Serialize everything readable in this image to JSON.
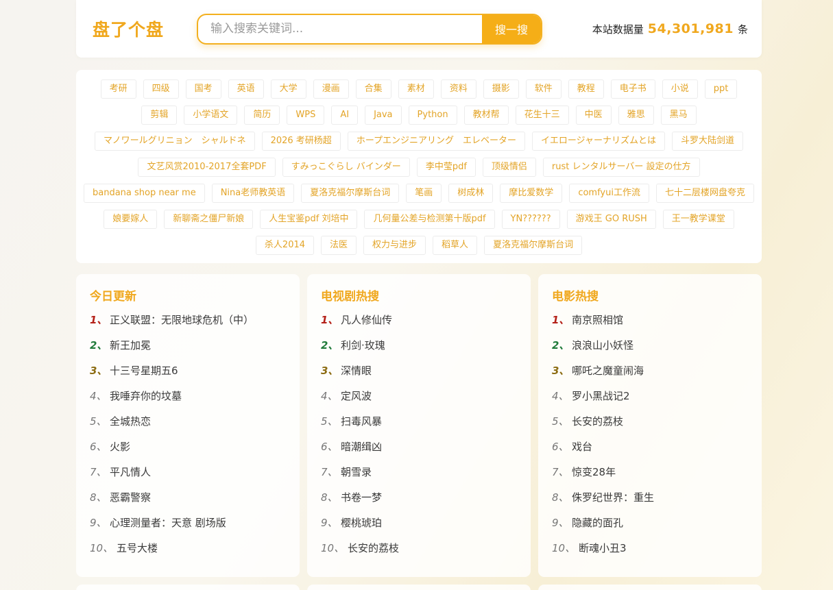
{
  "header": {
    "logo": "盘了个盘",
    "search_placeholder": "输入搜索关键词...",
    "search_button": "搜一搜",
    "stats_prefix": "本站数据量",
    "stats_count": "54,301,981",
    "stats_suffix": "条"
  },
  "tags": [
    "考研",
    "四级",
    "国考",
    "英语",
    "大学",
    "漫画",
    "合集",
    "素材",
    "资料",
    "摄影",
    "软件",
    "教程",
    "电子书",
    "小说",
    "ppt",
    "剪辑",
    "小学语文",
    "简历",
    "WPS",
    "AI",
    "Java",
    "Python",
    "教材帮",
    "花生十三",
    "中医",
    "雅思",
    "黑马",
    "マノワールグリニョン　シャルドネ",
    "2026 考研杨超",
    "ホープエンジニアリング　エレベーター",
    "イエロージャーナリズムとは",
    "斗罗大陆剑道",
    "文艺风赏2010-2017全套PDF",
    "すみっこぐらし バインダー",
    "李中莹pdf",
    "顶级情侣",
    "rust レンタルサーバー 設定の仕方",
    "bandana shop near me",
    "Nina老师教英语",
    "夏洛克福尔摩斯台词",
    "笔画",
    "树成林",
    "摩比爱数学",
    "comfyui工作流",
    "七十二层楼网盘夸克",
    "娘要嫁人",
    "新聊斋之僵尸新娘",
    "人生宝鉴pdf 刘培中",
    "几何量公差与检测第十版pdf",
    "YN??????",
    "游戏王 GO RUSH",
    "王一教学课堂",
    "杀人2014",
    "法医",
    "权力与进步",
    "稻草人",
    "夏洛克福尔摩斯台词"
  ],
  "cards": [
    {
      "title": "今日更新",
      "items": [
        "正义联盟：无限地球危机（中）",
        "新王加冕",
        "十三号星期五6",
        "我唾弃你的坟墓",
        "全城热恋",
        "火影",
        "平凡情人",
        "恶霸警察",
        "心理测量者：天意 剧场版",
        "五号大楼"
      ]
    },
    {
      "title": "电视剧热搜",
      "items": [
        "凡人修仙传",
        "利剑·玫瑰",
        "深情眼",
        "定风波",
        "扫毒风暴",
        "暗潮缉凶",
        "朝雪录",
        "书卷一梦",
        "樱桃琥珀",
        "长安的荔枝"
      ]
    },
    {
      "title": "电影热搜",
      "items": [
        "南京照相馆",
        "浪浪山小妖怪",
        "哪吒之魔童闹海",
        "罗小黑战记2",
        "长安的荔枝",
        "戏台",
        "惊变28年",
        "侏罗纪世界：重生",
        "隐藏的面孔",
        "断魂小丑3"
      ]
    }
  ],
  "ranks": [
    "1、",
    "2、",
    "3、",
    "4、",
    "5、",
    "6、",
    "7、",
    "8、",
    "9、",
    "10、"
  ],
  "colors": {
    "accent": "#f0a81e",
    "rank1": "#b42018",
    "rank2": "#1f7a3a",
    "rank3": "#8c6c12"
  }
}
